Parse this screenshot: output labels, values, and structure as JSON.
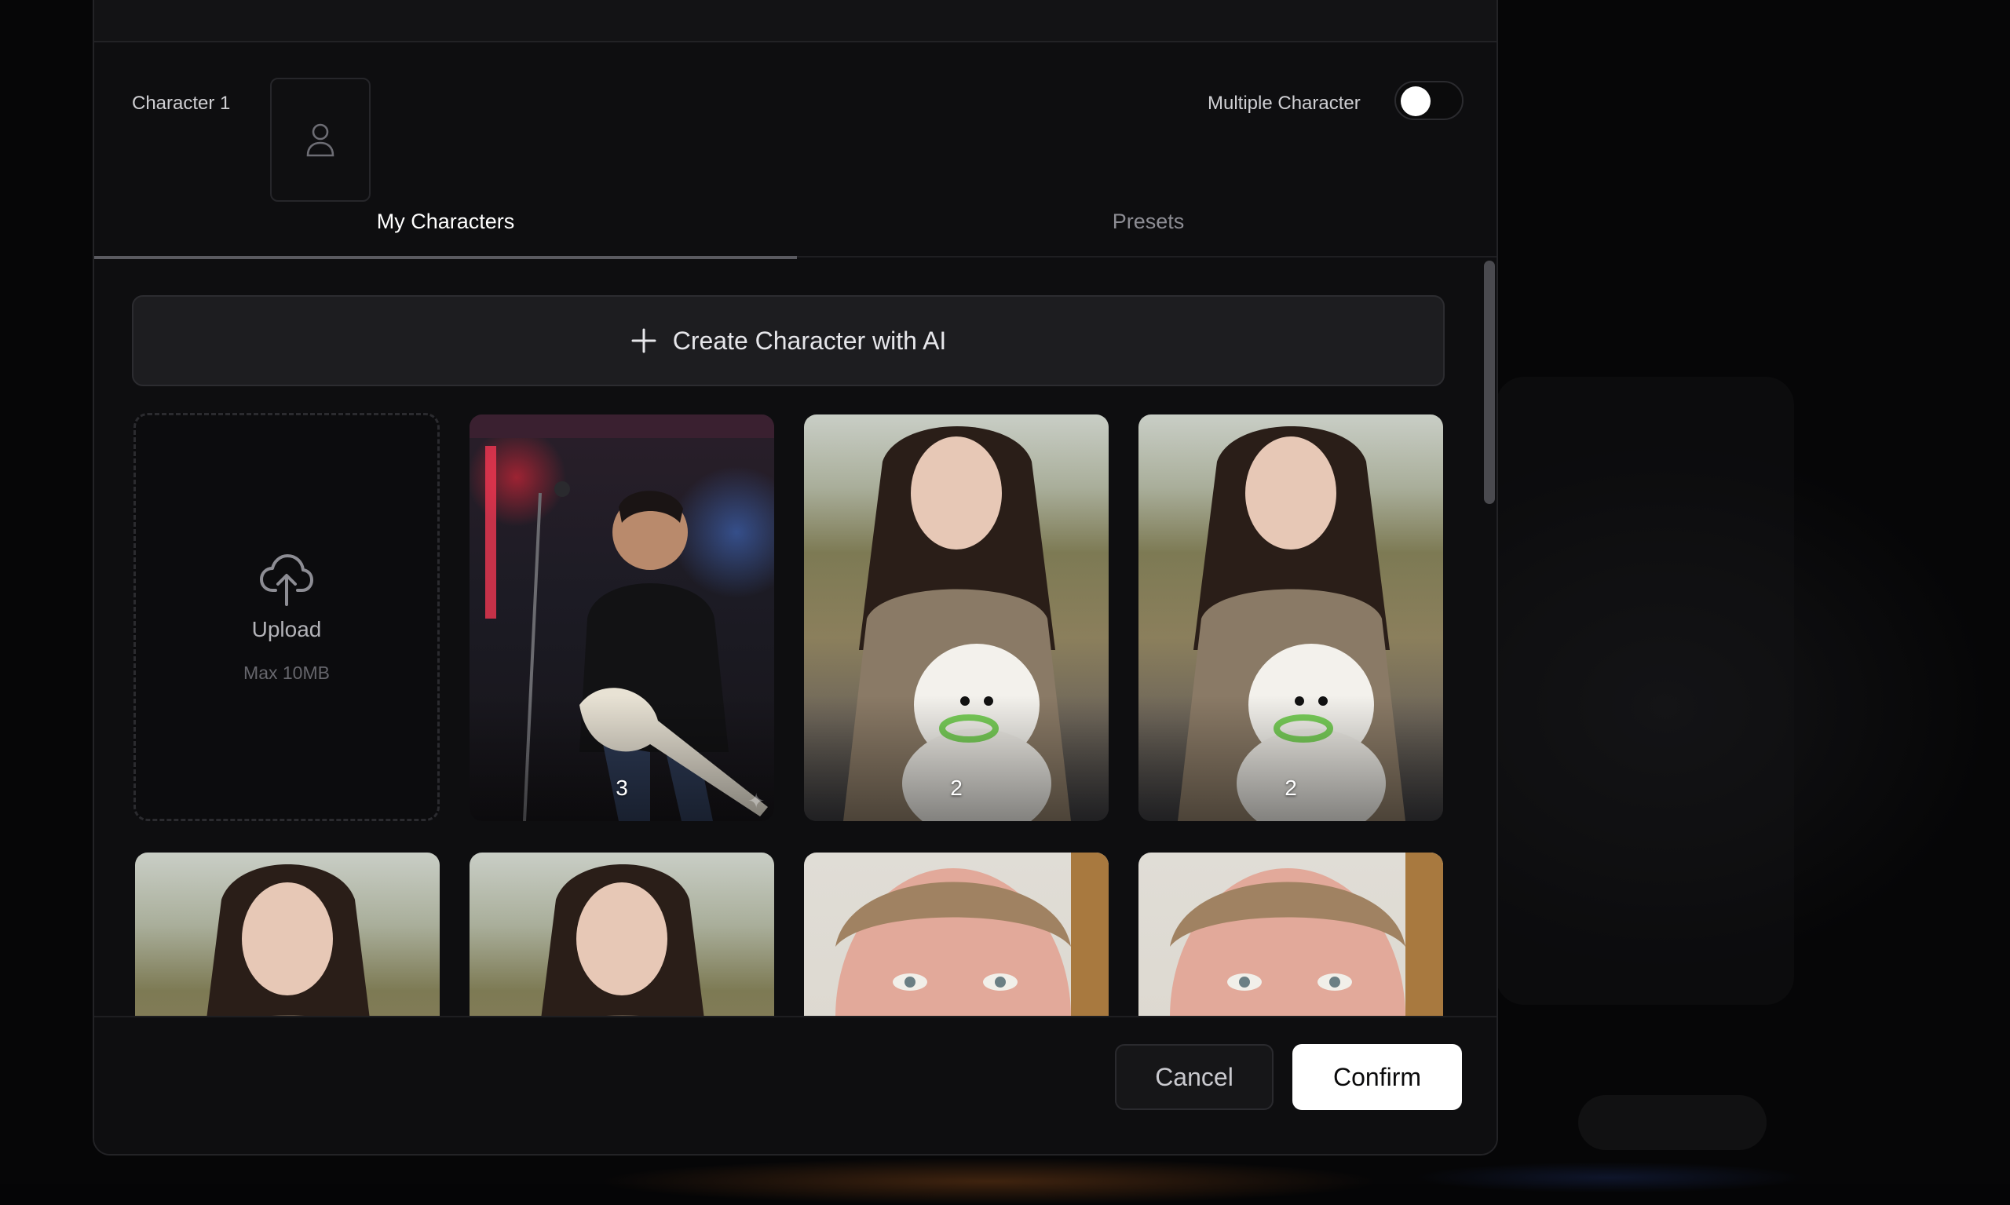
{
  "character_row": {
    "slot_label": "Character 1",
    "multiple_label": "Multiple Character",
    "multiple_enabled": false
  },
  "tabs": [
    {
      "label": "My Characters",
      "active": true
    },
    {
      "label": "Presets",
      "active": false
    }
  ],
  "create_button": {
    "label": "Create Character with AI",
    "icon": "plus-icon"
  },
  "upload": {
    "title": "Upload",
    "subtitle": "Max 10MB",
    "icon": "upload-cloud-icon"
  },
  "characters": [
    {
      "kind": "rock-guitarist",
      "count": "3"
    },
    {
      "kind": "girl-with-dog",
      "count": "2"
    },
    {
      "kind": "girl-with-dog",
      "count": "2"
    },
    {
      "kind": "girl-portrait",
      "count": ""
    },
    {
      "kind": "girl-portrait",
      "count": ""
    },
    {
      "kind": "man-closeup",
      "count": ""
    },
    {
      "kind": "man-closeup",
      "count": ""
    }
  ],
  "footer": {
    "cancel_label": "Cancel",
    "confirm_label": "Confirm"
  },
  "colors": {
    "accent": "#ffffff",
    "surface": "#0e0e10",
    "muted_text": "#8c8c93"
  }
}
